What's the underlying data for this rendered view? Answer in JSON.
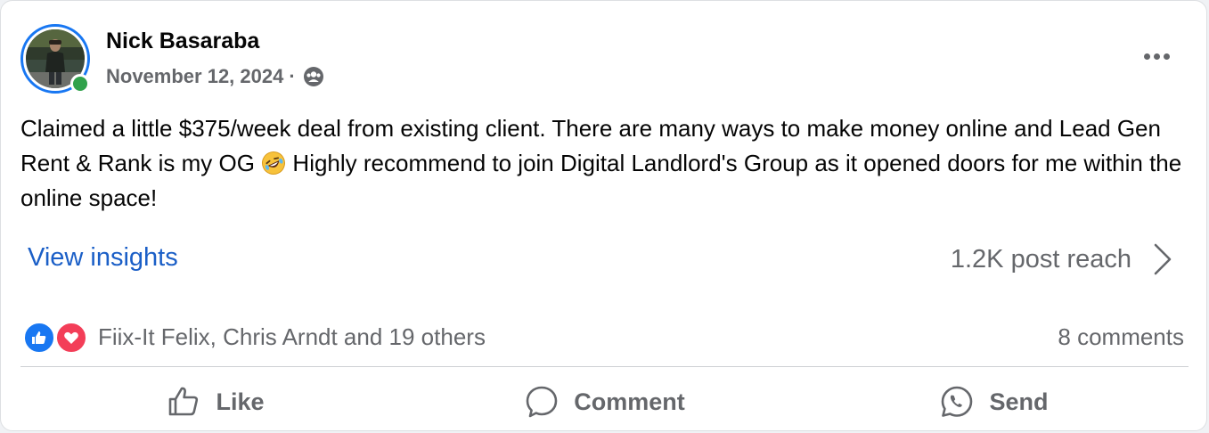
{
  "post": {
    "author": "Nick Basaraba",
    "date": "November 12, 2024",
    "separator": "·",
    "audience_icon": "friends-group-icon",
    "text_before_emoji": "Claimed a little $375/week deal from existing client. There are many ways to make money online and Lead Gen Rent & Rank is my OG ",
    "emoji": "rolling-on-floor-laughing-emoji",
    "text_after_emoji": " Highly recommend to join Digital Landlord's Group as it opened doors for me within the online space!"
  },
  "insights": {
    "label": "View insights",
    "reach": "1.2K post reach"
  },
  "engagement": {
    "reaction_icons": [
      "like-reaction-icon",
      "love-reaction-icon"
    ],
    "reactors": "Fiix-It Felix, Chris Arndt and 19 others",
    "comments": "8 comments"
  },
  "actions": {
    "like": "Like",
    "comment": "Comment",
    "send": "Send"
  },
  "colors": {
    "link_blue": "#1b5fc7",
    "accent_blue": "#1877f2",
    "online_green": "#31a24c",
    "love_red": "#f33e58",
    "secondary_text": "#65676b",
    "primary_text": "#050505"
  }
}
